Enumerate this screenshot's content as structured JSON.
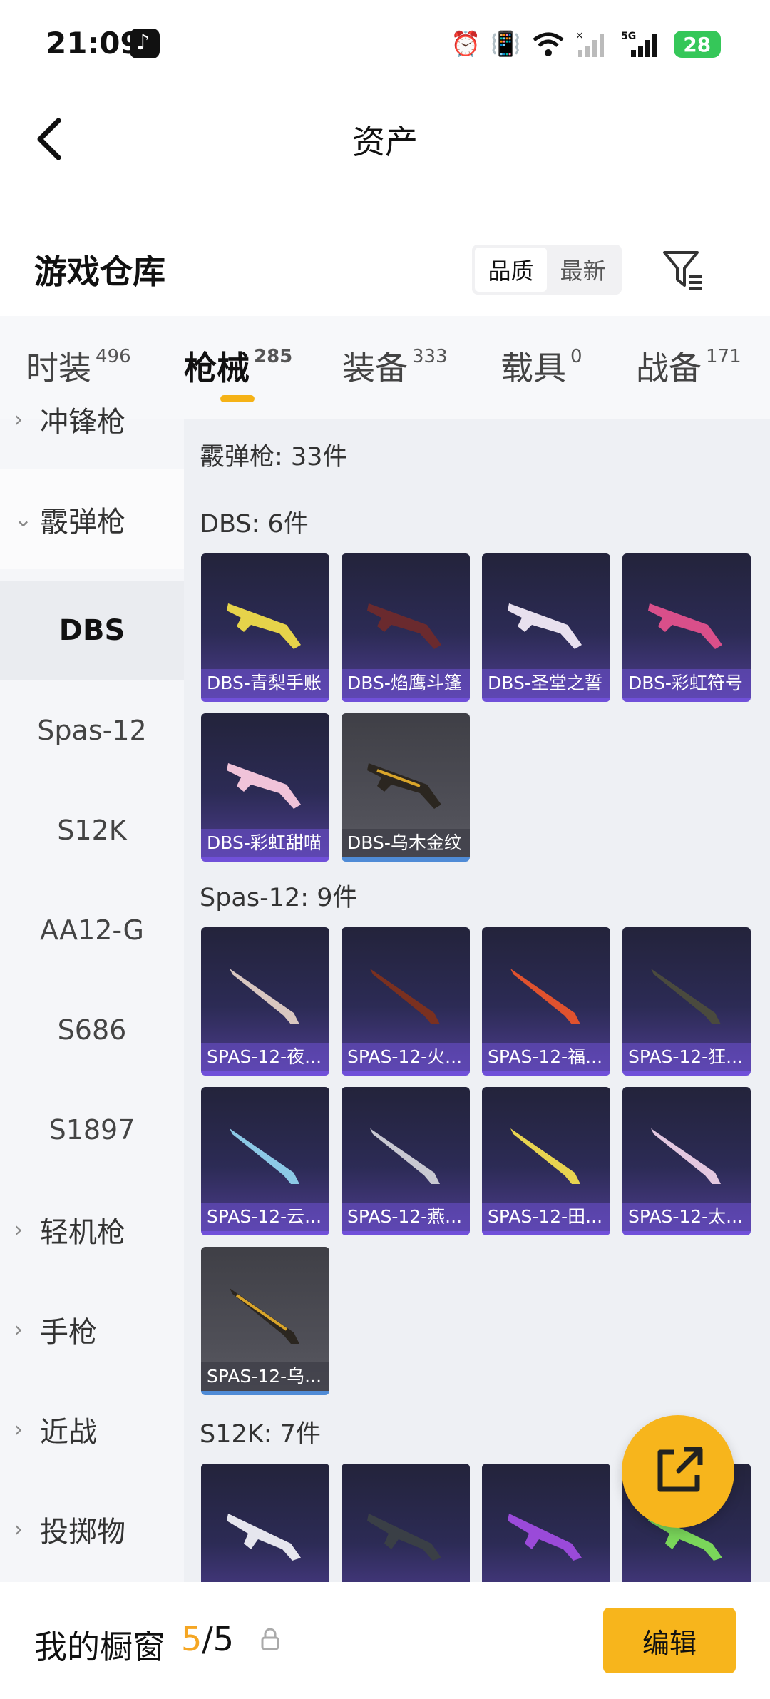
{
  "status": {
    "time": "21:09",
    "battery": "28",
    "icons": [
      "alarm-icon",
      "vibrate-icon",
      "wifi-icon",
      "signal-no-sim-icon",
      "signal-5g-icon",
      "battery-icon"
    ]
  },
  "header": {
    "title": "资产"
  },
  "warehouse": {
    "title": "游戏仓库",
    "sort": [
      {
        "label": "品质"
      },
      {
        "label": "最新"
      }
    ]
  },
  "tabs": [
    {
      "label": "时装",
      "count": "496"
    },
    {
      "label": "枪械",
      "count": "285"
    },
    {
      "label": "装备",
      "count": "333"
    },
    {
      "label": "载具",
      "count": "0"
    },
    {
      "label": "战备",
      "count": "171"
    }
  ],
  "sidebar": {
    "smg": "冲锋枪",
    "shotgun": "霰弹枪",
    "subs": [
      "DBS",
      "Spas-12",
      "S12K",
      "AA12-G",
      "S686",
      "S1897"
    ],
    "lmg": "轻机枪",
    "pistol": "手枪",
    "melee": "近战",
    "throwable": "投掷物"
  },
  "main": {
    "total": "霰弹枪: 33件",
    "sections": [
      {
        "title": "DBS: 6件",
        "items": [
          "DBS-青梨手账",
          "DBS-焰鹰斗篷",
          "DBS-圣堂之誓",
          "DBS-彩虹符号",
          "DBS-彩虹甜喵",
          "DBS-乌木金纹"
        ]
      },
      {
        "title": "Spas-12: 9件",
        "items": [
          "SPAS-12-夜...",
          "SPAS-12-火...",
          "SPAS-12-福...",
          "SPAS-12-狂...",
          "SPAS-12-云...",
          "SPAS-12-燕...",
          "SPAS-12-田...",
          "SPAS-12-太...",
          "SPAS-12-乌..."
        ]
      },
      {
        "title": "S12K: 7件",
        "items": []
      }
    ]
  },
  "bottom": {
    "title": "我的橱窗",
    "current": "5",
    "separator": "/",
    "max": "5",
    "edit_label": "编辑"
  },
  "colors": {
    "accent": "#f7b51c",
    "card_purple": "#2c2b55",
    "card_gray": "#505058"
  }
}
